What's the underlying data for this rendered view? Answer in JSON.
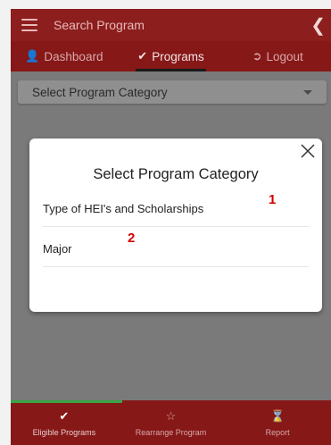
{
  "appbar": {
    "title": "Search Program"
  },
  "tabs": [
    {
      "label": "Dashboard",
      "icon": "person-icon"
    },
    {
      "label": "Programs",
      "icon": "check-icon",
      "active": true
    },
    {
      "label": "Logout",
      "icon": "logout-icon"
    }
  ],
  "select": {
    "placeholder": "Select Program Category"
  },
  "modal": {
    "title": "Select Program Category",
    "options": [
      {
        "label": "Type of HEI's and Scholarships",
        "annotation": "1"
      },
      {
        "label": "Major",
        "annotation": "2"
      }
    ]
  },
  "bottom_nav": [
    {
      "label": "Eligible Programs",
      "icon": "check-icon",
      "active": true
    },
    {
      "label": "Rearrange Program",
      "icon": "star-icon"
    },
    {
      "label": "Report",
      "icon": "report-icon"
    }
  ],
  "colors": {
    "primary": "#8c1e1e",
    "accent_progress": "#3aa346",
    "overlay": "#7a7a7a"
  }
}
